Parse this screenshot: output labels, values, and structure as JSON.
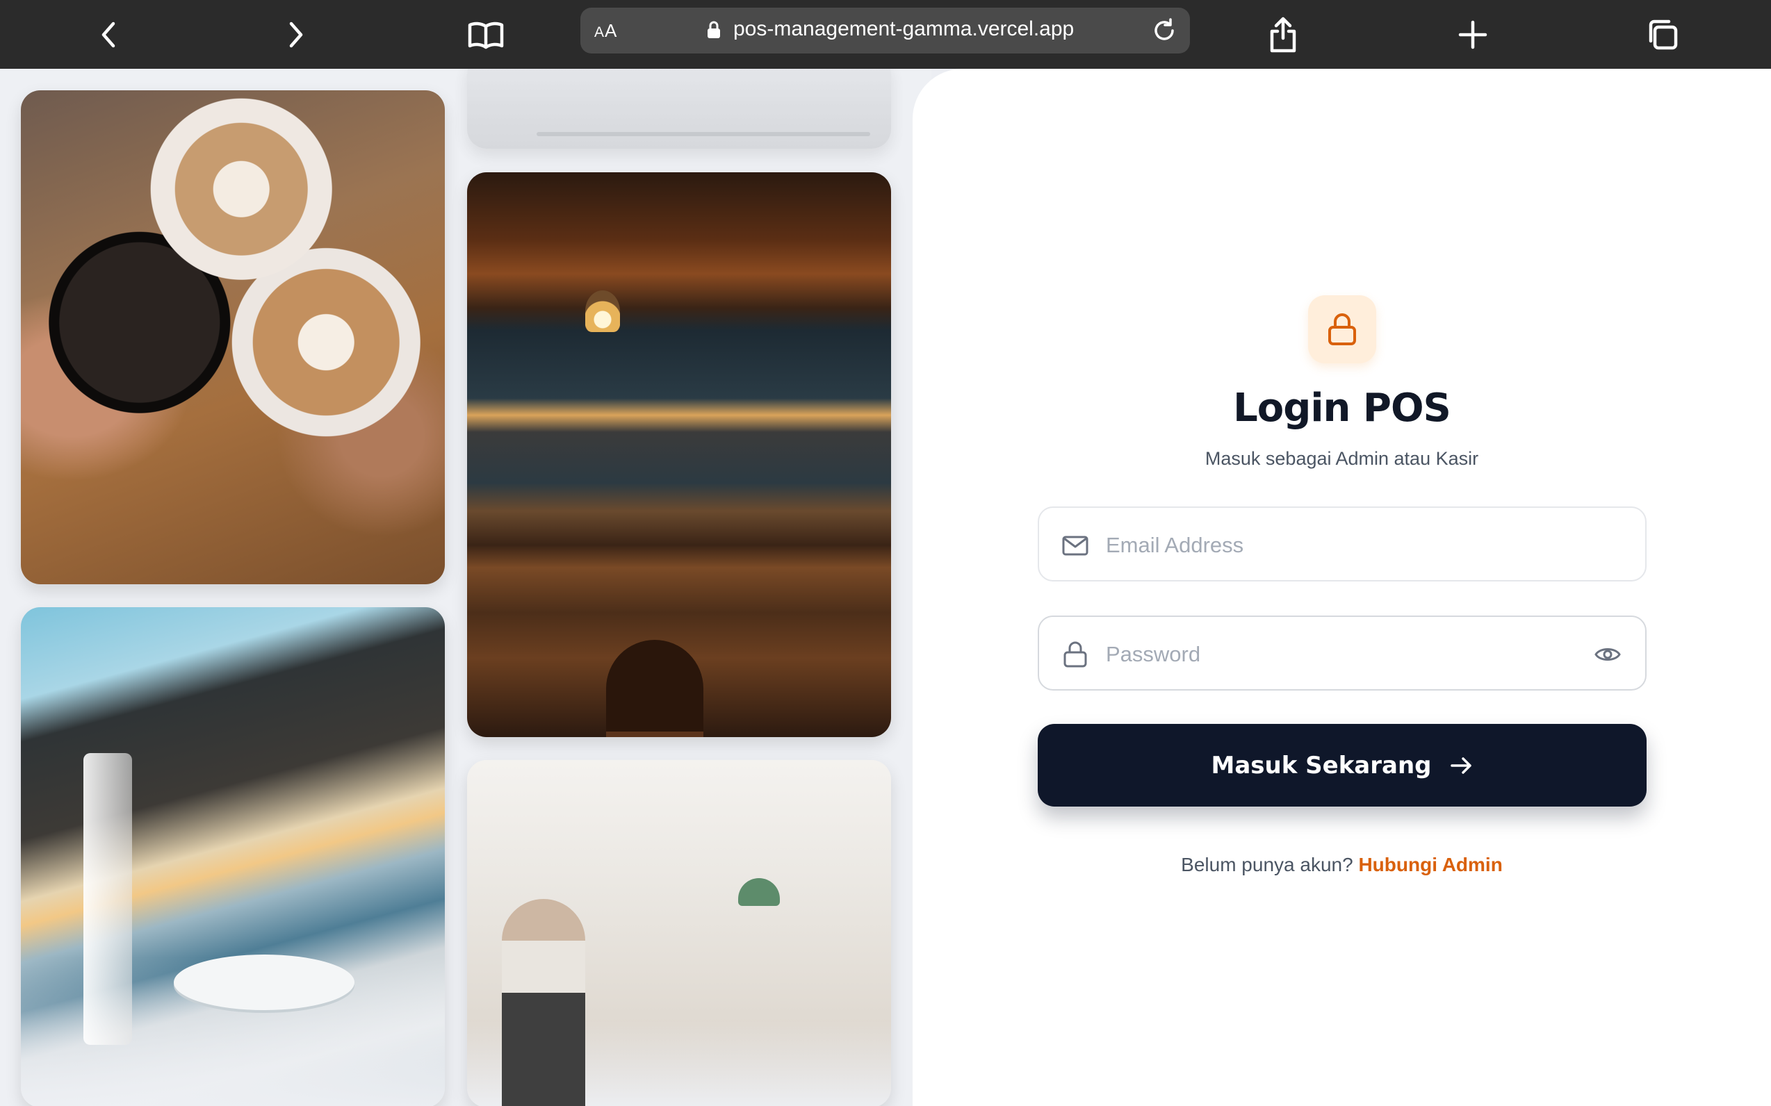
{
  "browser": {
    "text_size_label": "AA",
    "url": "pos-management-gamma.vercel.app"
  },
  "gallery": {
    "photos": [
      "coffee-cups",
      "restaurant-top",
      "bar-interior",
      "terrace-seaside",
      "coffee-shop"
    ]
  },
  "login": {
    "title": "Login POS",
    "subtitle": "Masuk sebagai Admin atau Kasir",
    "email_placeholder": "Email Address",
    "password_placeholder": "Password",
    "submit_label": "Masuk Sekarang",
    "footer_text": "Belum punya akun?",
    "footer_link": "Hubungi Admin"
  },
  "colors": {
    "accent": "#d9610c",
    "button_bg": "#0f172a",
    "badge_bg": "#ffeedb",
    "toolbar_bg": "#2b2b2b"
  },
  "icons": [
    "back-icon",
    "forward-icon",
    "book-icon",
    "lock-icon",
    "reload-icon",
    "share-icon",
    "plus-icon",
    "tabs-icon",
    "mail-icon",
    "eye-icon",
    "arrow-right-icon"
  ]
}
